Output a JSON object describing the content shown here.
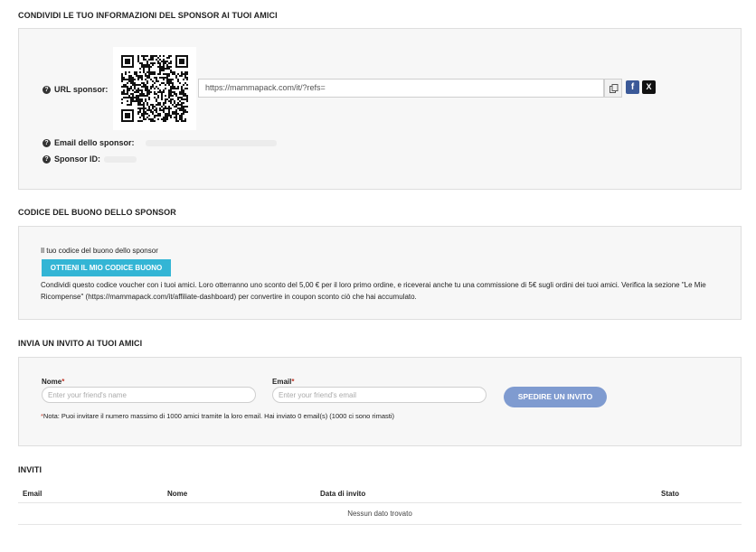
{
  "sponsor_info": {
    "title": "CONDIVIDI LE TUO INFORMAZIONI DEL SPONSOR AI TUOI AMICI",
    "url_label": "URL sponsor:",
    "url_value": "https://mammapack.com/it/?refs=",
    "email_label": "Email dello sponsor:",
    "id_label": "Sponsor ID:",
    "copy_icon": "copy-icon",
    "facebook_icon": "f",
    "x_icon": "X"
  },
  "voucher": {
    "title": "CODICE DEL BUONO DELLO SPONSOR",
    "label": "Il tuo codice del buono dello sponsor",
    "button": "OTTIENI IL MIO CODICE BUONO",
    "description": "Condividi questo codice voucher con i tuoi amici. Loro otterranno uno sconto del 5,00 € per il loro primo ordine, e riceverai anche tu una commissione di 5€ sugli ordini dei tuoi amici. Verifica la sezione \"Le Mie Ricompense\" (https://mammapack.com/it/affiliate-dashboard) per convertire in coupon sconto ciò che hai accumulato."
  },
  "invite": {
    "title": "INVIA UN INVITO AI TUOI AMICI",
    "name_label": "Nome",
    "name_placeholder": "Enter your friend's name",
    "email_label": "Email",
    "email_placeholder": "Enter your friend's email",
    "required_mark": "*",
    "button": "SPEDIRE UN INVITO",
    "note": "Nota: Puoi invitare il numero massimo di 1000 amici tramite la loro email. Hai inviato 0 email(s) (1000 ci sono rimasti)"
  },
  "invites_table": {
    "title": "INVITI",
    "columns": [
      "Email",
      "Nome",
      "Data di invito",
      "Stato"
    ],
    "empty_message": "Nessun dato trovato"
  },
  "colors": {
    "voucher_button": "#33b5d5",
    "invite_button": "#7f9bd0",
    "facebook": "#3b5998"
  }
}
